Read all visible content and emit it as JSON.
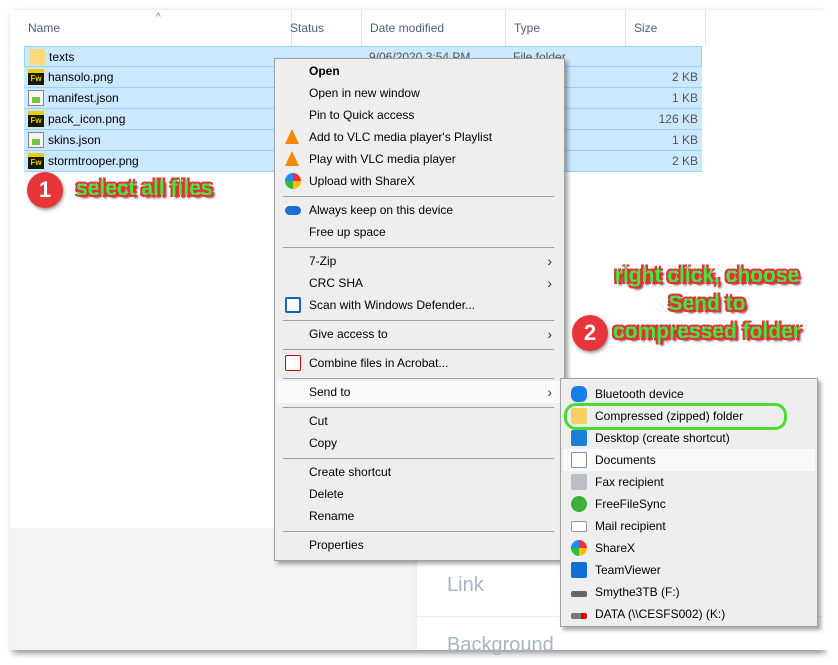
{
  "columns": [
    "Name",
    "Status",
    "Date modified",
    "Type",
    "Size"
  ],
  "files": [
    {
      "name": "texts",
      "icon": "folder-icon",
      "date": "9/06/2020 3:54 PM",
      "type": "File folder",
      "size": ""
    },
    {
      "name": "hansolo.png",
      "icon": "fireworks-file-icon",
      "size": "2 KB"
    },
    {
      "name": "manifest.json",
      "icon": "text-file-icon",
      "size": "1 KB"
    },
    {
      "name": "pack_icon.png",
      "icon": "fireworks-file-icon",
      "size": "126 KB"
    },
    {
      "name": "skins.json",
      "icon": "text-file-icon",
      "size": "1 KB"
    },
    {
      "name": "stormtrooper.png",
      "icon": "fireworks-file-icon",
      "size": "2 KB"
    }
  ],
  "context_menu": {
    "items": [
      "Open",
      "Open in new window",
      "Pin to Quick access",
      "Add to VLC media player's Playlist",
      "Play with VLC media player",
      "Upload with ShareX",
      "Always keep on this device",
      "Free up space",
      "7-Zip",
      "CRC SHA",
      "Scan with Windows Defender...",
      "Give access to",
      "Combine files in Acrobat...",
      "Send to",
      "Cut",
      "Copy",
      "Create shortcut",
      "Delete",
      "Rename",
      "Properties"
    ]
  },
  "send_to": {
    "items": [
      "Bluetooth device",
      "Compressed (zipped) folder",
      "Desktop (create shortcut)",
      "Documents",
      "Fax recipient",
      "FreeFileSync",
      "Mail recipient",
      "ShareX",
      "TeamViewer",
      "Smythe3TB (F:)",
      "DATA (\\\\CESFS002) (K:)"
    ]
  },
  "background_panel": {
    "link": "Link",
    "background": "Background"
  },
  "annotations": {
    "step1_number": "1",
    "step1_text": "select all files",
    "step2_number": "2",
    "step2_text": "right click, choose Send to compressed folder",
    "highlight_color": "#4ddc2c",
    "badge_color": "#e8353a"
  }
}
